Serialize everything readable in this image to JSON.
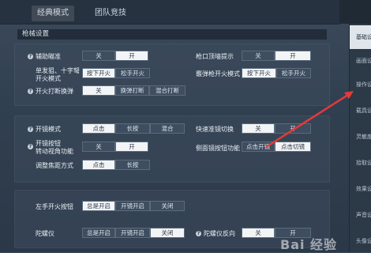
{
  "topbar": {
    "tabs": [
      {
        "label": "经典模式",
        "active": true
      },
      {
        "label": "团队竞技",
        "active": false
      }
    ]
  },
  "section": {
    "title": "枪械设置"
  },
  "panel1": {
    "rows": [
      {
        "label": "辅助瞄准",
        "help": true,
        "options": [
          "关",
          "开"
        ],
        "selected": "开"
      },
      {
        "label": "单发狙、十字弩\n开火模式",
        "help": false,
        "options": [
          "按下开火",
          "松手开火"
        ],
        "selected": "按下开火"
      },
      {
        "label": "开火打断换弹",
        "help": true,
        "options": [
          "关",
          "换弹打断",
          "混合打断"
        ],
        "selected": "关"
      }
    ],
    "right_rows": [
      {
        "label": "枪口顶墙提示",
        "options": [
          "关",
          "开"
        ],
        "selected": "开"
      },
      {
        "label": "霰弹枪开火模式",
        "options": [
          "按下开火",
          "松手开火"
        ],
        "selected": "按下开火"
      }
    ]
  },
  "panel2": {
    "rows": [
      {
        "label": "开镜模式",
        "help": true,
        "options": [
          "点击",
          "长按",
          "混合"
        ],
        "selected": "点击"
      },
      {
        "label": "开镜按钮\n转动视角功能",
        "help": true,
        "options": [
          "关",
          "开"
        ],
        "selected": "开"
      },
      {
        "label": "调整焦距方式",
        "help": false,
        "options": [
          "点击",
          "长按"
        ],
        "selected": "点击"
      }
    ],
    "right_rows": [
      {
        "label": "快速准镜切换",
        "options": [
          "关",
          "开"
        ],
        "selected": "关"
      },
      {
        "label": "侧面镜按钮功能",
        "options": [
          "点击开镜",
          "点击切镜"
        ],
        "selected": "点击开镜"
      }
    ]
  },
  "panel3": {
    "rows": [
      {
        "label": "左手开火按钮",
        "help": false,
        "options": [
          "总是开启",
          "开镜开启",
          "关闭"
        ],
        "selected": "总是开启"
      },
      {
        "label": "陀螺仪",
        "help": false,
        "options": [
          "总是开启",
          "开镜开启",
          "关闭"
        ],
        "selected": "关闭"
      }
    ],
    "right_rows": [
      {
        "label": "陀螺仪反向",
        "help": true,
        "options": [
          "关",
          "开"
        ],
        "selected": "关"
      }
    ]
  },
  "sidebar": {
    "items": [
      {
        "label": "基础设置",
        "active": true
      },
      {
        "label": "画面设置",
        "active": false
      },
      {
        "label": "操作设置",
        "active": false
      },
      {
        "label": "载具设置",
        "active": false
      },
      {
        "label": "灵敏度设置",
        "active": false
      },
      {
        "label": "拾取设置",
        "active": false
      },
      {
        "label": "效果设置",
        "active": false
      },
      {
        "label": "声音设置",
        "active": false
      },
      {
        "label": "头像设置",
        "active": false
      }
    ]
  },
  "watermark": {
    "text": "Bai 经验"
  },
  "colors": {
    "selected_bg": "#f2f4f6",
    "unselected_bg": "#3e4d5f",
    "annotation_arrow": "#e23a3a"
  }
}
